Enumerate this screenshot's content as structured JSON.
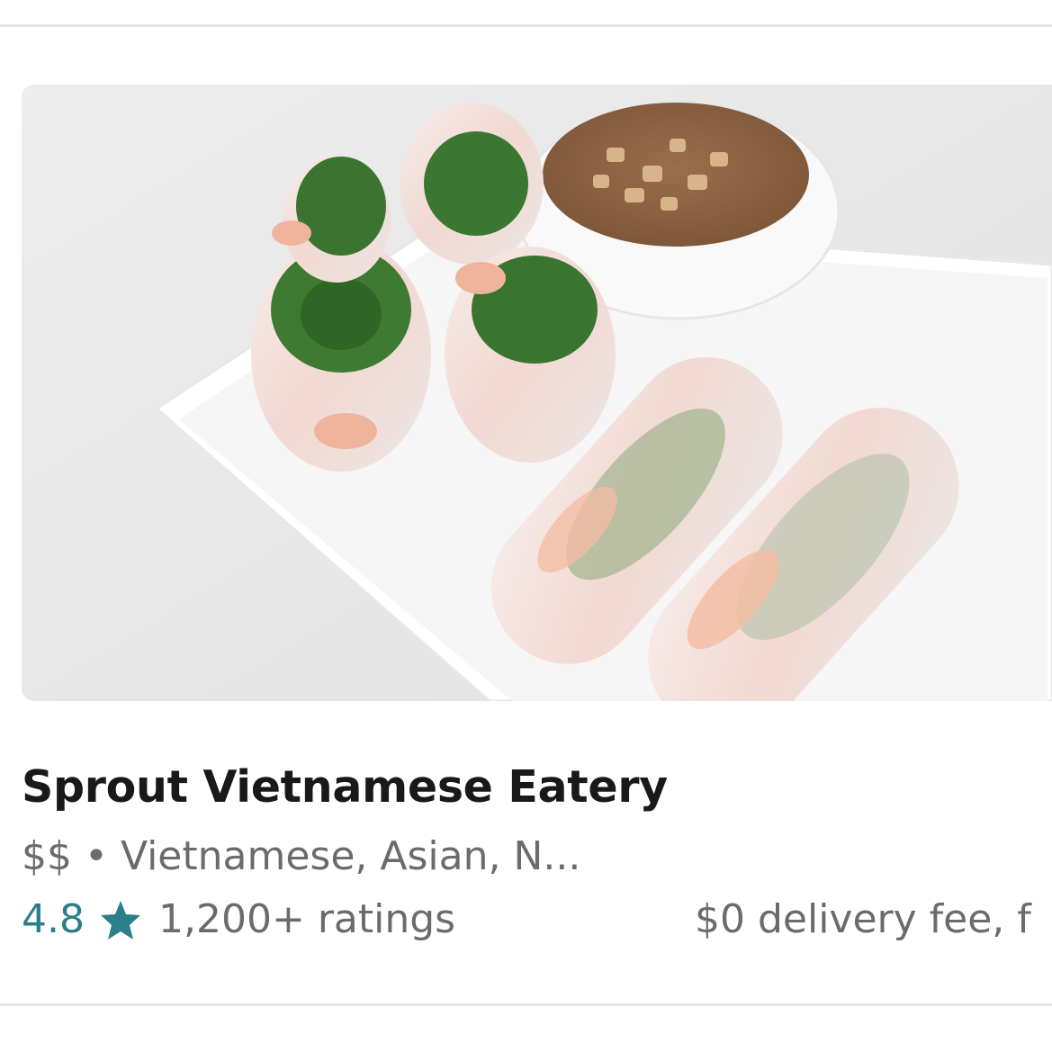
{
  "store": {
    "name": "Sprout Vietnamese Eatery",
    "price": "$$",
    "separator": "•",
    "cuisines": "Vietnamese, Asian, N...",
    "rating": "4.8",
    "ratings_count": "1,200+ ratings",
    "delivery": "$0 delivery fee, f",
    "image_icon": "food-photo"
  },
  "colors": {
    "rating_accent": "#2a7f89",
    "secondary_text": "#6b6b6b",
    "primary_text": "#191919",
    "divider": "#e6e6e6"
  }
}
